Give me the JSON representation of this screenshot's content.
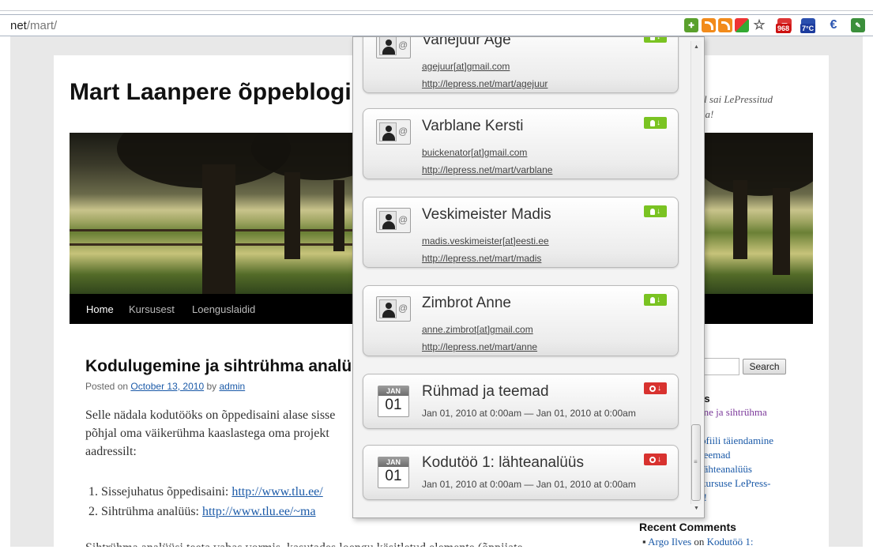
{
  "browser": {
    "url_host": "net",
    "url_path": "/mart/",
    "weather_badge": "968",
    "temp_badge": "7°C"
  },
  "blog": {
    "title": "Mart Laanpere õppeblogi",
    "description": "päeval sai LePressitud amahla!",
    "nav": [
      "Home",
      "Kursusest",
      "Loenguslaidid"
    ],
    "post": {
      "title": "Kodulugemine ja sihtrühma analü",
      "meta_prefix": "Posted on",
      "date": "October 13, 2010",
      "meta_by": "by",
      "author": "admin",
      "body_lines": [
        "Selle nädala kodutööks on õppedisaini alase sisse",
        "põhjal oma väikerühma kaaslastega oma projekt",
        "aadressilt:"
      ],
      "list": [
        {
          "num": "1.",
          "label": "Sissejuhatus õppedisaini:",
          "link": "http://www.tlu.ee/"
        },
        {
          "num": "2.",
          "label": "Sihtrühma analüüs:",
          "link": "http://www.tlu.ee/~ma"
        }
      ],
      "cutoff_line": "Sihtrühma analüüsi teeta vabas vormis, kasutades loengu käsitletud elemente (õppijate"
    },
    "sidebar": {
      "search_button": "Search",
      "recent_posts_heading": "ts",
      "recent_posts": [
        "ine ja sihtrühma",
        "ofiili täiendamine",
        "teemad",
        "lähteanalüüs",
        "kursuse LePress-",
        "t!"
      ],
      "recent_comments_heading": "Recent Comments",
      "comment_author": "Argo Ilves",
      "comment_on": "on",
      "comment_post": "Kodutöö 1:"
    }
  },
  "popup": {
    "contacts": [
      {
        "name": "Vahejuur Age",
        "email": "agejuur[at]gmail.com",
        "url": "http://lepress.net/mart/agejuur"
      },
      {
        "name": "Varblane Kersti",
        "email": "buickenator[at]gmail.com",
        "url": "http://lepress.net/mart/varblane"
      },
      {
        "name": "Veskimeister Madis",
        "email": "madis.veskimeister[at]eesti.ee",
        "url": "http://lepress.net/mart/madis"
      },
      {
        "name": "Zimbrot Anne",
        "email": "anne.zimbrot[at]gmail.com",
        "url": "http://lepress.net/mart/anne"
      }
    ],
    "events": [
      {
        "month": "JAN",
        "day": "01",
        "title": "Rühmad ja teemad",
        "time": "Jan 01, 2010 at 0:00am — Jan 01, 2010 at 0:00am"
      },
      {
        "month": "JAN",
        "day": "01",
        "title": "Kodutöö 1: lähteanalüüs",
        "time": "Jan 01, 2010 at 0:00am — Jan 01, 2010 at 0:00am"
      }
    ]
  }
}
